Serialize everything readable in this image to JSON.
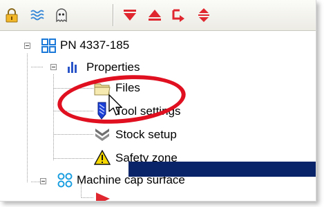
{
  "toolbar": {
    "buttons": [
      {
        "icon": "lock-icon"
      },
      {
        "icon": "waves-icon"
      },
      {
        "icon": "ghost-icon"
      },
      {
        "icon": "triangle-down-icon"
      },
      {
        "icon": "triangle-up-icon"
      },
      {
        "icon": "step-arrow-icon"
      },
      {
        "icon": "up-down-arrow-icon"
      }
    ]
  },
  "tree": {
    "root": {
      "label": "PN 4337-185",
      "icon": "grid-icon"
    },
    "properties": {
      "label": "Properties",
      "icon": "bar-chart-icon"
    },
    "files": {
      "label": "Files",
      "icon": "folder-icon"
    },
    "tool_settings": {
      "label": "Tool settings",
      "icon": "tool-bit-icon"
    },
    "stock_setup": {
      "label": "Stock setup",
      "icon": "stock-icon"
    },
    "safety_zone": {
      "label": "Safety zone",
      "icon": "warning-icon"
    },
    "machine_cap": {
      "label": "Machine cap surface",
      "icon": "circles-icon"
    },
    "selected_child": {
      "label": "",
      "icon": "play-arrow-icon"
    }
  },
  "colors": {
    "highlight_ring": "#e01020",
    "selection": "#0a246a",
    "toolbar_red": "#e0262e"
  }
}
